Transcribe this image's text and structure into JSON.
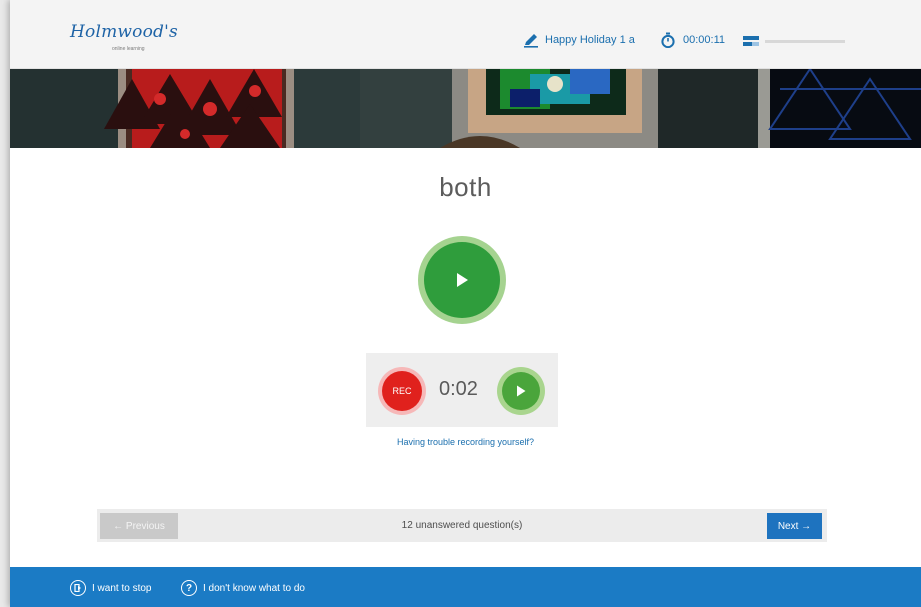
{
  "header": {
    "logo_text": "Holmwood's",
    "logo_tagline": "online learning",
    "lesson_title": "Happy Holiday 1 a",
    "timer": "00:00:11",
    "progress_fraction": 0
  },
  "question": {
    "word": "both"
  },
  "recorder": {
    "rec_label": "REC",
    "elapsed": "0:02",
    "help_link": "Having trouble recording yourself?"
  },
  "navigation": {
    "previous_label": "← Previous",
    "status": "12 unanswered question(s)",
    "next_label": "Next →"
  },
  "footer": {
    "stop_label": "I want to stop",
    "help_label": "I don't know what to do"
  },
  "colors": {
    "brand_blue": "#1b7bc5",
    "play_green": "#2f9d3c",
    "rec_red": "#e0211d"
  }
}
